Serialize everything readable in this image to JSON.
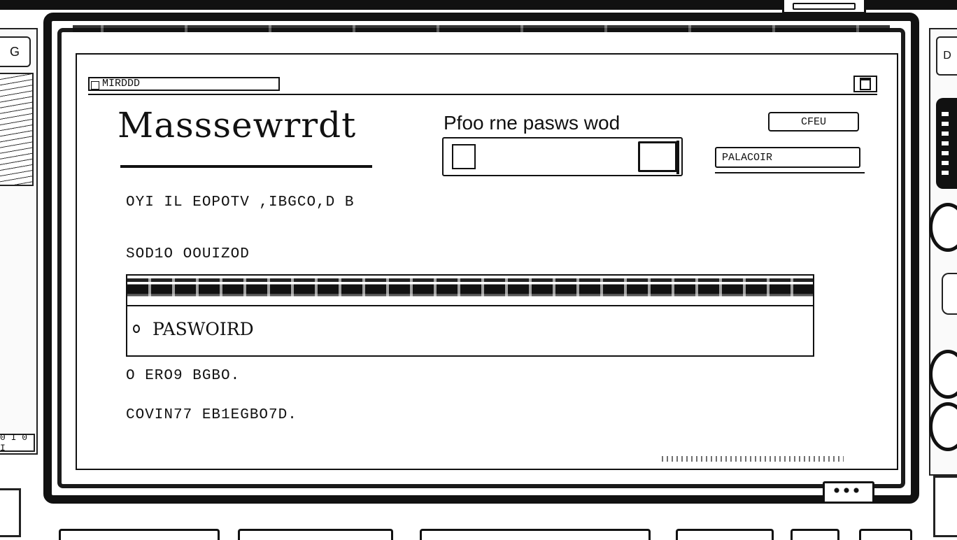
{
  "window": {
    "title": "MIRDDD",
    "controls_glyph": "window-control"
  },
  "heading": "Masssewrrdt",
  "prompt": {
    "label": "Pfoo rne pasws wod"
  },
  "top_right": {
    "button_label": "CFEU",
    "field_value": "PALACOIR"
  },
  "lines": {
    "line1": "OYI IL EOPOTV ,IBGCO,D B",
    "line2": "SOD1O OOUIZOD",
    "line3": "O ERO9 BGBO.",
    "line4": "COVIN77 EB1EGBO7D."
  },
  "password_panel": {
    "option_label": "PASWOIRD"
  },
  "side": {
    "left_button": "G",
    "left_label": "0 I 0 I",
    "right_button": "D"
  },
  "colors": {
    "ink": "#111111",
    "paper": "#ffffff"
  }
}
